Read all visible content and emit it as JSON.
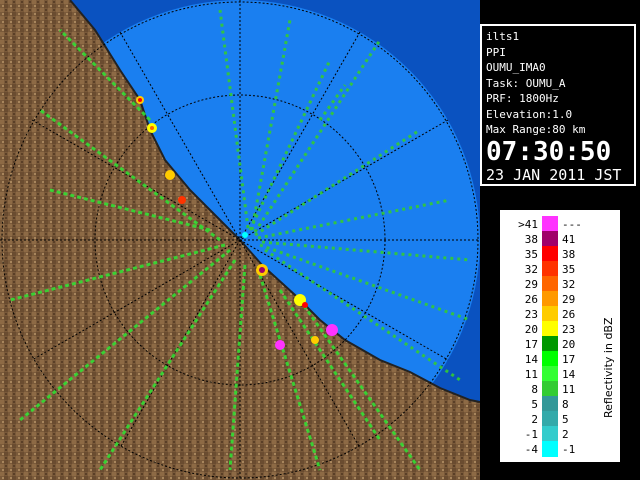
{
  "info": {
    "site": "ilts1",
    "mode": "PPI",
    "product": "OUMU_IMA0",
    "task": "Task: OUMU_A",
    "prf": "PRF: 1800Hz",
    "elevation": "Elevation:1.0",
    "max_range": "Max Range:80 km",
    "time": "07:30:50",
    "date": "23 JAN 2011 JST"
  },
  "legend": {
    "title": "Reflectivity in dBZ",
    "rows": [
      {
        "left": ">41",
        "right": "---",
        "color": "#ff33ff"
      },
      {
        "left": "38",
        "right": "41",
        "color": "#a0006a"
      },
      {
        "left": "35",
        "right": "38",
        "color": "#ff0000"
      },
      {
        "left": "32",
        "right": "35",
        "color": "#ff3300"
      },
      {
        "left": "29",
        "right": "32",
        "color": "#ff6600"
      },
      {
        "left": "26",
        "right": "29",
        "color": "#ff9900"
      },
      {
        "left": "23",
        "right": "26",
        "color": "#ffcc00"
      },
      {
        "left": "20",
        "right": "23",
        "color": "#ffff00"
      },
      {
        "left": "17",
        "right": "20",
        "color": "#009900"
      },
      {
        "left": "14",
        "right": "17",
        "color": "#00ff00"
      },
      {
        "left": "11",
        "right": "14",
        "color": "#33ff33"
      },
      {
        "left": "8",
        "right": "11",
        "color": "#33cc33"
      },
      {
        "left": "5",
        "right": "8",
        "color": "#339999"
      },
      {
        "left": "2",
        "right": "5",
        "color": "#33aaaa"
      },
      {
        "left": "-1",
        "right": "2",
        "color": "#33cccc"
      },
      {
        "left": "-4",
        "right": "-1",
        "color": "#00ffff"
      }
    ]
  },
  "colors": {
    "sea": "#0a64d8",
    "sea_inner": "#1a7ff0",
    "land": "#7a5a3a",
    "land_light": "#9c7a55",
    "coast": "#000000",
    "range_ring": "#000000",
    "echo": "#33cc33"
  }
}
